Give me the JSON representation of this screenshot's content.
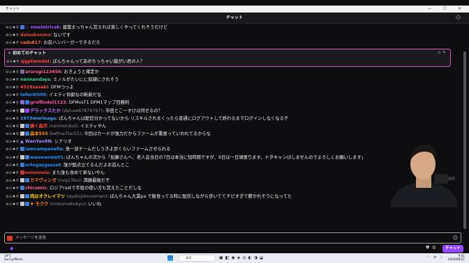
{
  "window": {
    "title": "チャット",
    "controls": "— ☐ ✕"
  },
  "header": {
    "title": "チャット"
  },
  "pinned": {
    "heading": "初めてのチャット",
    "user": "sjgptwmdat",
    "message": "ばんちゃんってあのちっちゃい龍がい君の人？"
  },
  "messages": [
    {
      "user": "omeletricek",
      "color": "#9e5cff",
      "badges": [
        "#3a7bd5"
      ],
      "prefix": "☆",
      "text": ": 建築まっちゃん覚えれば楽しくやってくれそうだけど"
    },
    {
      "user": "daisukunmo",
      "color": "#e0473a",
      "badges": [],
      "text": ": ないです"
    },
    {
      "user": "cads817",
      "color": "#ff6a3d",
      "badges": [],
      "text": ": お前ハンバーガーできるだろ"
    },
    {
      "user": "ararsgi123456",
      "color": "#ff5c8a",
      "badges": [
        "#7a6a9c"
      ],
      "text": ": おきょうと確定か"
    },
    {
      "user": "nannandays",
      "color": "#3ecf8e",
      "badges": [],
      "text": ": ミノルがたいにに奴隷にされそう"
    },
    {
      "user": "4519sasaki",
      "color": "#ff4040",
      "badges": [],
      "text": ": DFMつっよ"
    },
    {
      "user": "teferi0509",
      "color": "#1e90ff",
      "badges": [],
      "text": ": イエティ仰僻なの斬新だな"
    },
    {
      "user": "grolfindel1123",
      "color": "#ff4fa3",
      "badges": [
        "#8a6ad6",
        "#3a7bd5"
      ],
      "text": ": DFMvsT1 DFM1マップ目勝利"
    },
    {
      "user": "デラックスたか",
      "aka": "(deluxe67876767)",
      "color": "#c070ff",
      "badges": [
        "#ccc",
        "#9147ff"
      ],
      "text": ": 市田とこーすけは何せるの？"
    },
    {
      "user": "1973morinaga",
      "color": "#3aa0ff",
      "badges": [],
      "text": ": ばんちゃんは配信分かってないから リスキルされまくったら普通にログアウトして終わるまでログインしなくなるぞ"
    },
    {
      "user": "練く森作",
      "aka": "(nerimorikul)",
      "color": "#ff4040",
      "badges": [
        "#ccc",
        "#3a7bd5"
      ],
      "text": ": イエティやん"
    },
    {
      "user": "森本555",
      "aka": "(kafma7tar55)",
      "color": "#ff8c00",
      "badges": [
        "#ccc",
        "#3a7bd5"
      ],
      "text": ": 今回はカードが強力だからファームが重要っていわれてるからな"
    },
    {
      "user": "WanYan8N",
      "color": "#9e8cff",
      "badges": [],
      "prefix": "▲",
      "text": ": シナリオ"
    },
    {
      "user": "iamcampanella",
      "color": "#1e90ff",
      "badges": [
        "#3a7bd5"
      ],
      "text": ": 島一部チームだしうきよ歩くらいファームさせられる"
    },
    {
      "user": "wanwanwe01",
      "color": "#1e90ff",
      "badges": [
        "#ccc",
        "#3a7bd5"
      ],
      "text": ": ばんちゃんの次から「加藤さんへ、老人会当日の7日は本当に短時間ですが、9日は一日頑張ります。ドタキャンはしませんのでよろしくお願いします」"
    },
    {
      "user": "ortegaygasset",
      "color": "#1e90ff",
      "badges": [
        "#3a7bd5"
      ],
      "text": ": 誰が酷点立てるんだよお前んとこ"
    },
    {
      "user": "onionnoiz",
      "color": "#ff4040",
      "badges": [
        "#cc3333"
      ],
      "text": ": また誰も攻めて来ないやん"
    },
    {
      "user": "カマヴィンガ",
      "aka": "(nvg13bu)",
      "color": "#ff6a3d",
      "badges": [
        "#ccc",
        "#3a7bd5"
      ],
      "text": ": 満勝最後だぞ"
    },
    {
      "user": "chicomic",
      "color": "#ff5c8a",
      "badges": [
        "#3a7bd5"
      ],
      "text": ": ロジアrustで手殺の使い方も覚えたことだしな"
    },
    {
      "user": "肉はオクレイマツ",
      "aka": "(ayatujokureiman)",
      "color": "#ffd700",
      "badges": [
        "#ccc",
        "#3a7bd5"
      ],
      "text": ": ばんちゃん大業pa で飯食ってる時に配信しながら歩いててチビすぎて鬱かれそうになってた"
    },
    {
      "user": "モクク",
      "aka": "(mokumokukyu)",
      "color": "#ff8c00",
      "badges": [
        "#ccc",
        "#3a7bd5"
      ],
      "prefix": "♦",
      "text": ": いいね"
    }
  ],
  "input": {
    "placeholder": "メッセージを送信"
  },
  "chat_button": "チャット",
  "taskbar": {
    "weather": "19°C",
    "weather_sub": "Sunny/Warm",
    "search": "検索",
    "time": "9:41",
    "date": "2024/09/21"
  }
}
